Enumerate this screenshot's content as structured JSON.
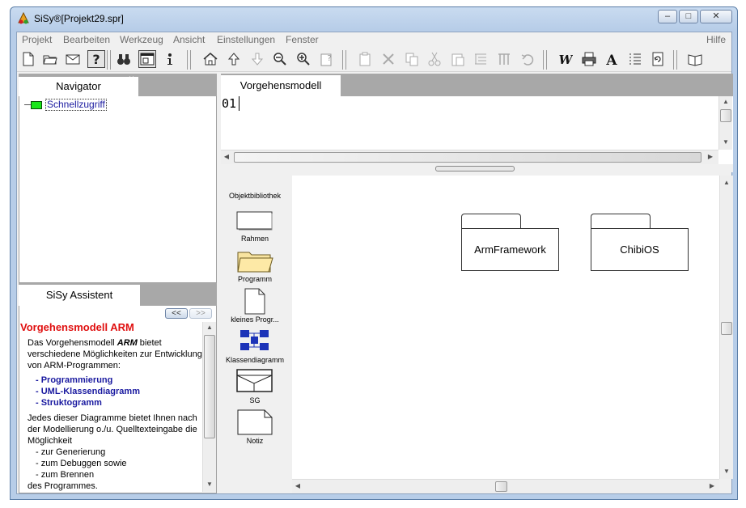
{
  "window": {
    "title": "SiSy®[Projekt29.spr]",
    "controls": {
      "minimize": "▭",
      "maximize": "▢",
      "close": "✕"
    }
  },
  "menubar": {
    "items": [
      "Projekt",
      "Bearbeiten",
      "Werkzeug",
      "Ansicht",
      "Einstellungen",
      "Fenster"
    ],
    "help": "Hilfe"
  },
  "toolbar": {
    "buttons": [
      "new-document-icon",
      "open-folder-icon",
      "mail-icon",
      "help-question-icon",
      "binoculars-icon",
      "window-frame-icon",
      "info-icon",
      "home-icon",
      "arrow-up-icon",
      "arrow-down-icon",
      "zoom-out-icon",
      "zoom-in-icon",
      "clipboard-help-icon",
      "paste-icon",
      "cut-x-icon",
      "copy-icon",
      "scissors-icon",
      "clipboard-icon",
      "list-icon",
      "columns-icon",
      "undo-icon",
      "word-icon",
      "print-icon",
      "font-icon",
      "bullet-list-icon",
      "refresh-doc-icon",
      "book-icon"
    ]
  },
  "navigator": {
    "tab_label": "Navigator",
    "close_glyph": "×",
    "tree": [
      {
        "label": "Schnellzugriff"
      }
    ]
  },
  "assistant": {
    "tab_label": "SiSy Assistent",
    "nav_prev": "<<",
    "nav_next": ">>",
    "title": "Vorgehensmodell ARM",
    "intro_1": "Das Vorgehensmodell ",
    "intro_bold": "ARM",
    "intro_2": " bietet",
    "intro_line2": "verschiedene Möglichkeiten zur Entwicklung",
    "intro_line3": "von ARM-Programmen:",
    "links": [
      "-  Programmierung",
      "-  UML-Klassendiagramm",
      "-  Struktogramm"
    ],
    "body_line1": "Jedes dieser Diagramme bietet Ihnen nach",
    "body_line2": "der Modellierung o./u. Quelltexteingabe die",
    "body_line3": "Möglichkeit",
    "subitems": [
      "-  zur Generierung",
      "-  zum Debuggen sowie",
      "-  zum Brennen"
    ],
    "body_line4": "des Programmes."
  },
  "editor": {
    "tab_label": "Vorgehensmodell",
    "close_glyph": "×",
    "content": "01"
  },
  "library": {
    "title": "Objektbibliothek",
    "items": [
      "Rahmen",
      "Programm",
      "kleines Progr...",
      "Klassendiagramm",
      "SG",
      "Notiz"
    ]
  },
  "diagram": {
    "packages": [
      "ArmFramework",
      "ChibiOS"
    ]
  }
}
